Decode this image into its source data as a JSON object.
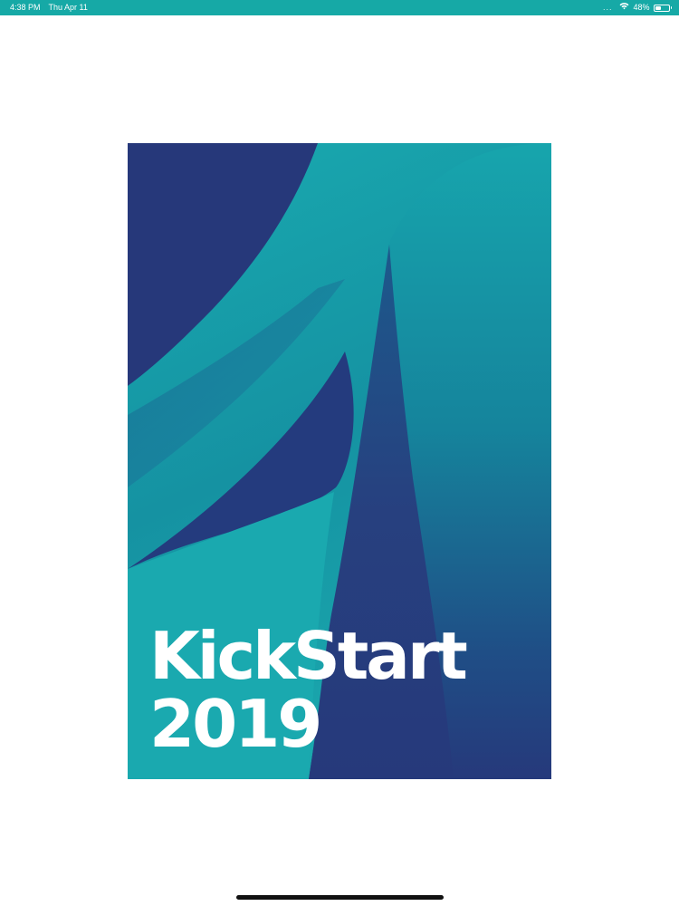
{
  "status_bar": {
    "time": "4:38 PM",
    "date": "Thu Apr 11",
    "dots": "...",
    "wifi_icon": "wifi-icon",
    "battery_percent": "48%",
    "battery_level": 0.48,
    "battery_icon": "battery-icon",
    "color": "#16a9a6"
  },
  "poster": {
    "title": "KickStart",
    "year": "2019",
    "colors": {
      "teal": "#16a9ae",
      "navy": "#26387a"
    }
  }
}
